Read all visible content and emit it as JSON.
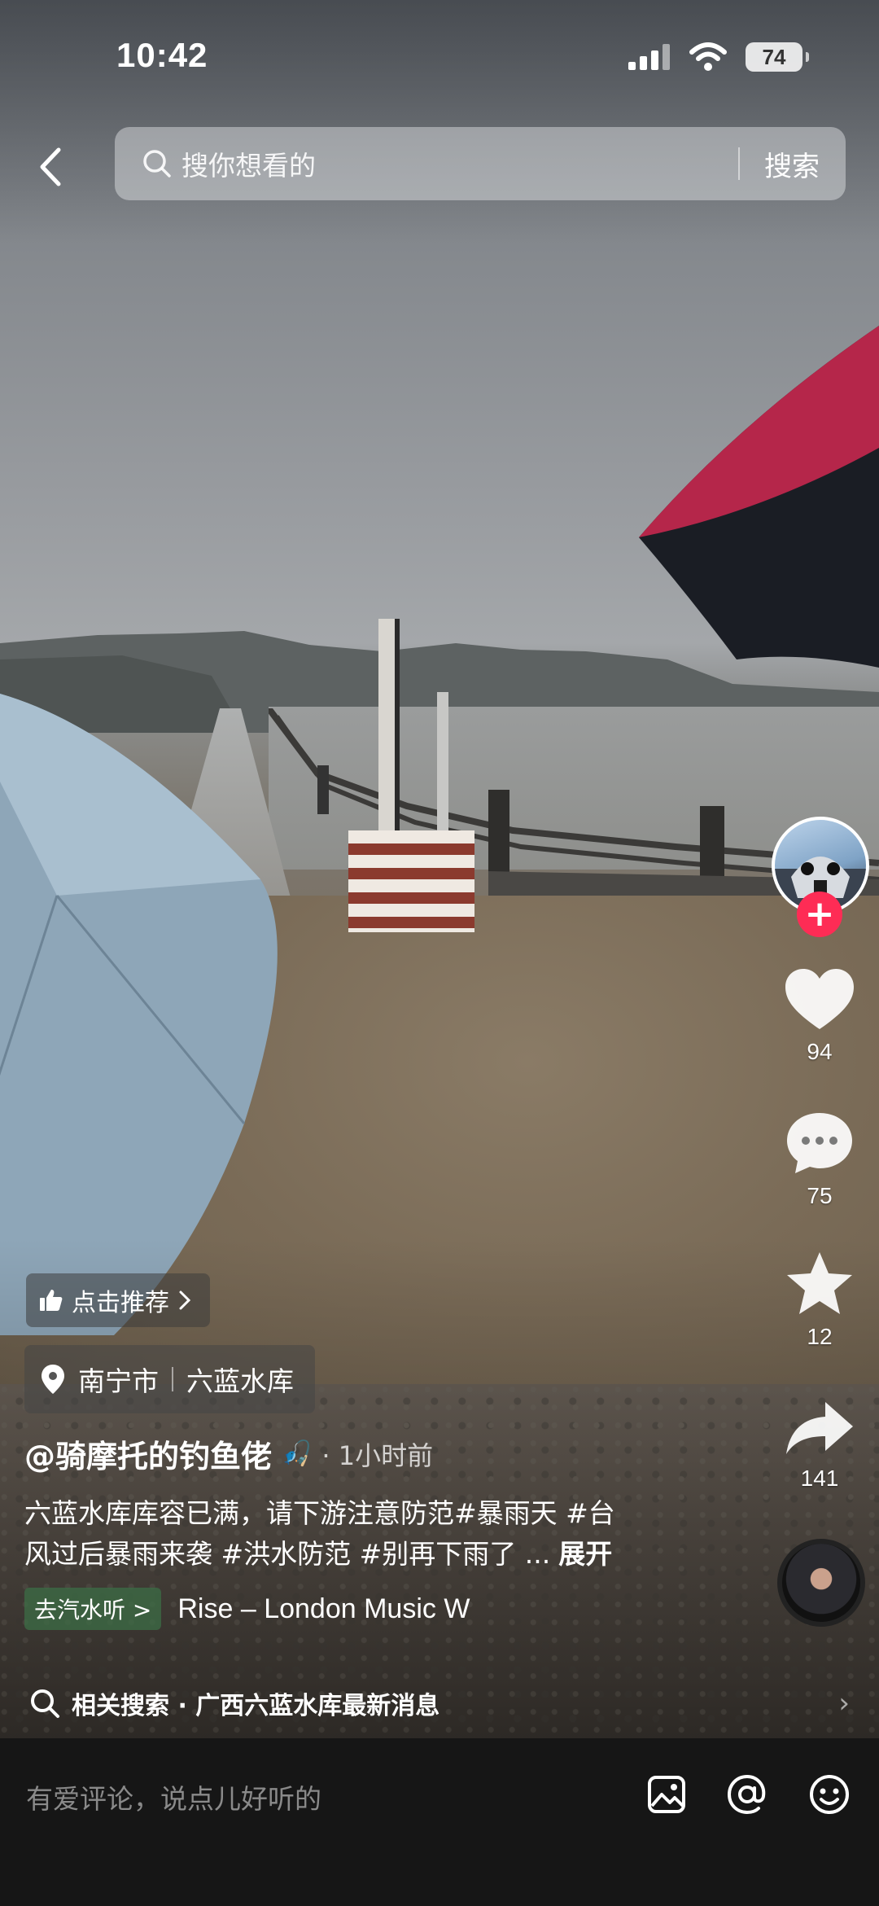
{
  "status_bar": {
    "time": "10:42",
    "battery": "74"
  },
  "search": {
    "placeholder": "搜你想看的",
    "button": "搜索"
  },
  "actions": {
    "likes": "94",
    "comments": "75",
    "favorites": "12",
    "shares": "141"
  },
  "recommend_label": "点击推荐",
  "location": {
    "city": "南宁市",
    "place": "六蓝水库"
  },
  "author": {
    "handle": "@骑摩托的钓鱼佬",
    "emoji": "🎣",
    "time_ago": "· 1小时前"
  },
  "description": {
    "line1": "六蓝水库库容已满，请下游注意防范#暴雨天 #台",
    "line2": "风过后暴雨来袭 #洪水防范 #别再下雨了 ...",
    "expand": "展开"
  },
  "music": {
    "tag": "去汽水听 >",
    "title": "Rise – London Music W"
  },
  "related": {
    "label": "相关搜索 · 广西六蓝水库最新消息"
  },
  "comment": {
    "placeholder": "有爱评论，说点儿好听的"
  },
  "colors": {
    "accent": "#fe2c55",
    "comment_bar": "#161616"
  },
  "icons": [
    "back-icon",
    "search-icon",
    "heart-icon",
    "comment-icon",
    "star-icon",
    "share-icon",
    "location-pin-icon",
    "thumbs-up-icon",
    "image-icon",
    "at-icon",
    "emoji-icon"
  ]
}
